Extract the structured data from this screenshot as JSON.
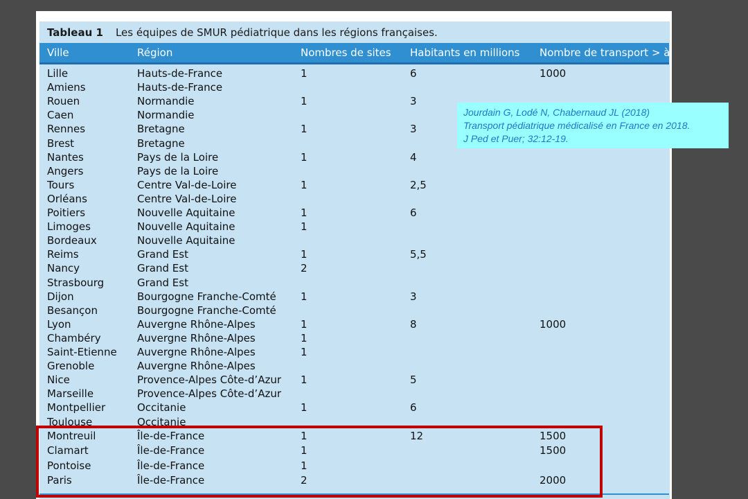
{
  "caption": {
    "number": "Tableau 1",
    "title": "Les équipes de SMUR pédiatrique dans les régions françaises."
  },
  "columns": [
    "Ville",
    "Région",
    "Nombres de sites",
    "Habitants en millions",
    "Nombre de transport > à"
  ],
  "rows": [
    [
      "Lille",
      "Hauts-de-France",
      "1",
      "6",
      "1000"
    ],
    [
      "Amiens",
      "Hauts-de-France",
      "",
      "",
      ""
    ],
    [
      "Rouen",
      "Normandie",
      "1",
      "3",
      ""
    ],
    [
      "Caen",
      "Normandie",
      "",
      "",
      ""
    ],
    [
      "Rennes",
      "Bretagne",
      "1",
      "3",
      ""
    ],
    [
      "Brest",
      "Bretagne",
      "",
      "",
      ""
    ],
    [
      "Nantes",
      "Pays de la Loire",
      "1",
      "4",
      ""
    ],
    [
      "Angers",
      "Pays de la Loire",
      "",
      "",
      ""
    ],
    [
      "Tours",
      "Centre Val-de-Loire",
      "1",
      "2,5",
      ""
    ],
    [
      "Orléans",
      "Centre Val-de-Loire",
      "",
      "",
      ""
    ],
    [
      "Poitiers",
      "Nouvelle Aquitaine",
      "1",
      "6",
      ""
    ],
    [
      "Limoges",
      "Nouvelle Aquitaine",
      "1",
      "",
      ""
    ],
    [
      "Bordeaux",
      "Nouvelle Aquitaine",
      "",
      "",
      ""
    ],
    [
      "Reims",
      "Grand Est",
      "1",
      "5,5",
      ""
    ],
    [
      "Nancy",
      "Grand Est",
      "2",
      "",
      ""
    ],
    [
      "Strasbourg",
      "Grand Est",
      "",
      "",
      ""
    ],
    [
      "Dijon",
      "Bourgogne Franche-Comté",
      "1",
      "3",
      ""
    ],
    [
      "Besançon",
      "Bourgogne Franche-Comté",
      "",
      "",
      ""
    ],
    [
      "Lyon",
      "Auvergne Rhône-Alpes",
      "1",
      "8",
      "1000"
    ],
    [
      "Chambéry",
      "Auvergne Rhône-Alpes",
      "1",
      "",
      ""
    ],
    [
      "Saint-Etienne",
      "Auvergne Rhône-Alpes",
      "1",
      "",
      ""
    ],
    [
      "Grenoble",
      "Auvergne Rhône-Alpes",
      "",
      "",
      ""
    ],
    [
      "Nice",
      "Provence-Alpes Côte-d’Azur",
      "1",
      "5",
      ""
    ],
    [
      "Marseille",
      "Provence-Alpes Côte-d’Azur",
      "",
      "",
      ""
    ],
    [
      "Montpellier",
      "Occitanie",
      "1",
      "6",
      ""
    ],
    [
      "Toulouse",
      "Occitanie",
      "",
      "",
      ""
    ]
  ],
  "highlighted_rows": [
    [
      "Montreuil",
      "Île-de-France",
      "1",
      "12",
      "1500"
    ],
    [
      "Clamart",
      "Île-de-France",
      "1",
      "",
      "1500"
    ],
    [
      "Pontoise",
      "Île-de-France",
      "1",
      "",
      ""
    ],
    [
      "Paris",
      "Île-de-France",
      "2",
      "",
      "2000"
    ]
  ],
  "citation": [
    "Jourdain G, Lodé N, Chabernaud JL (2018)",
    "Transport pédiatrique médicalisé en France en 2018.",
    "J Ped et Puer; 32:12-19."
  ],
  "colors": {
    "header": "#2f8fd0",
    "panel": "#c6e2f3",
    "highlight_border": "#c00000",
    "citation_bg": "#99ffff",
    "citation_text": "#1f78c8"
  }
}
